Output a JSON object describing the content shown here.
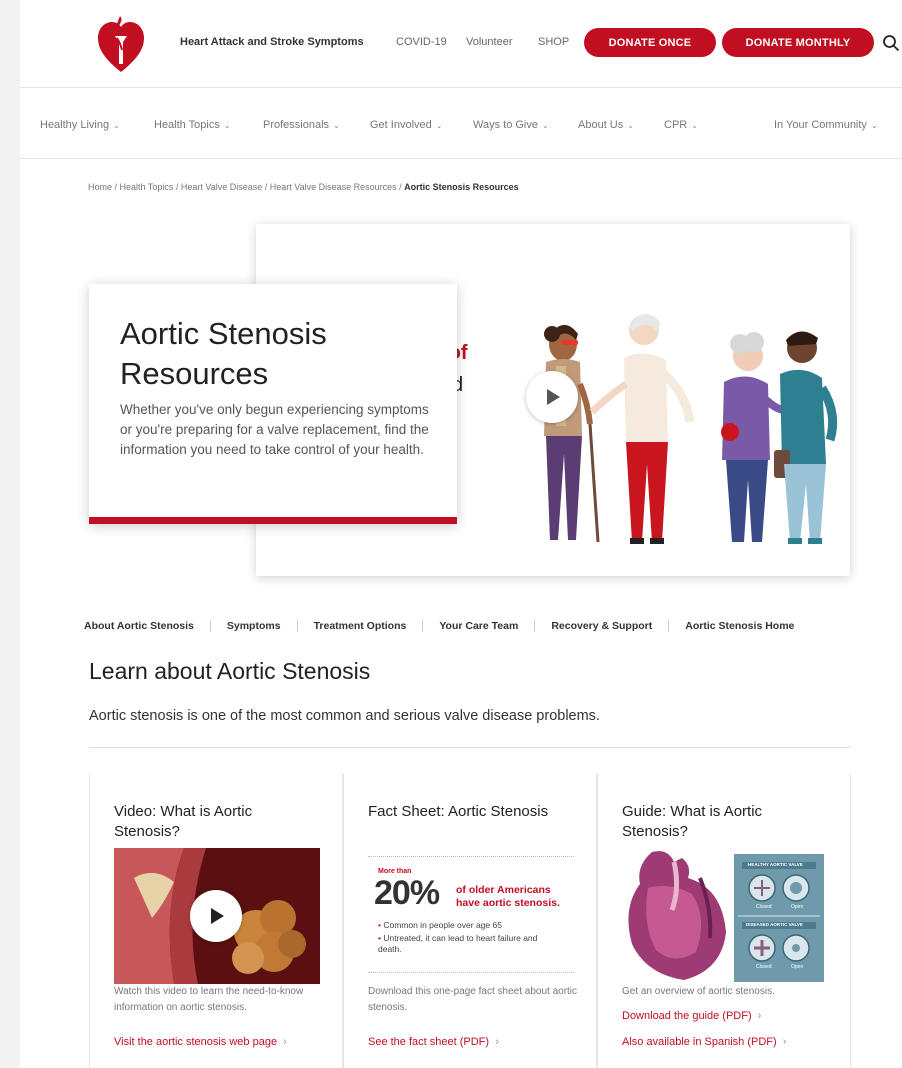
{
  "header": {
    "links": [
      "Heart Attack and Stroke Symptoms",
      "COVID-19",
      "Volunteer",
      "SHOP"
    ],
    "donate_once": "DONATE ONCE",
    "donate_monthly": "DONATE MONTHLY"
  },
  "nav": {
    "items": [
      "Healthy Living",
      "Health Topics",
      "Professionals",
      "Get Involved",
      "Ways to Give",
      "About Us",
      "CPR",
      "In Your Community"
    ]
  },
  "breadcrumb": {
    "path": "Home / Health Topics / Heart Valve Disease / Heart Valve Disease Resources / ",
    "current": "Aortic Stenosis Resources"
  },
  "hero": {
    "title": "Aortic Stenosis Resources",
    "description": "Whether you've only begun experiencing symptoms or you're preparing for a valve replacement, find the information you need to take control of your health.",
    "video_partial_line1": "s of",
    "video_partial_line2": "d"
  },
  "subnav": {
    "items": [
      "About Aortic Stenosis",
      "Symptoms",
      "Treatment Options",
      "Your Care Team",
      "Recovery & Support",
      "Aortic Stenosis Home"
    ]
  },
  "section": {
    "title": "Learn about Aortic Stenosis",
    "intro": "Aortic stenosis is one of the most common and serious valve disease problems."
  },
  "cards": [
    {
      "title": "Video: What is Aortic Stenosis?",
      "description": "Watch this video to learn the need-to-know information on aortic stenosis.",
      "links": [
        "Visit the aortic stenosis web page"
      ]
    },
    {
      "title": "Fact Sheet: Aortic Stenosis",
      "description": "Download this one-page fact sheet about aortic stenosis.",
      "links": [
        "See the fact sheet (PDF)"
      ],
      "factsheet": {
        "more_than": "More than",
        "percent": "20%",
        "headline": "of older Americans have aortic stenosis.",
        "bullets": [
          "Common in people over age 65",
          "Untreated, it can lead to heart failure and death."
        ]
      }
    },
    {
      "title": "Guide: What is Aortic Stenosis?",
      "description": "Get an overview of aortic stenosis.",
      "links": [
        "Download the guide (PDF)",
        "Also available in Spanish (PDF)"
      ],
      "guide_panels": {
        "top_label": "HEALTHY AORTIC VALVE",
        "bottom_label": "DISEASED AORTIC VALVE",
        "closed": "Closed",
        "open": "Open"
      }
    }
  ],
  "colors": {
    "brand_red": "#c10e21"
  }
}
